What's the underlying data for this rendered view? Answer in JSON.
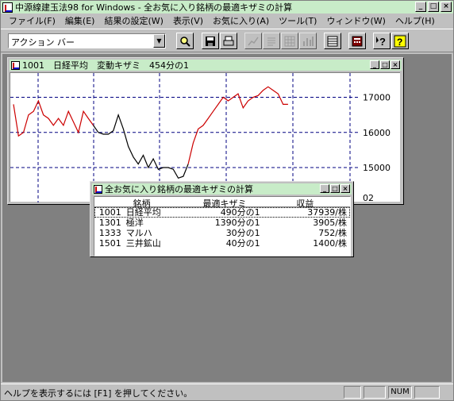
{
  "app": {
    "title": "中源線建玉法98 for Windows - 全お気に入り銘柄の最適キザミの計算"
  },
  "menu": [
    {
      "label": "ファイル(F)"
    },
    {
      "label": "編集(E)"
    },
    {
      "label": "結果の設定(W)"
    },
    {
      "label": "表示(V)"
    },
    {
      "label": "お気に入り(A)"
    },
    {
      "label": "ツール(T)"
    },
    {
      "label": "ウィンドウ(W)"
    },
    {
      "label": "ヘルプ(H)"
    }
  ],
  "toolbar": {
    "action_bar_value": "アクション バー"
  },
  "chart_window": {
    "title": "1001　日経平均　変動キザミ　454分の1",
    "axis_partial_label": "02"
  },
  "chart_data": {
    "type": "line",
    "x": [
      0,
      1,
      2,
      3,
      4,
      5,
      6,
      7,
      8,
      9,
      10,
      11,
      12,
      13,
      14,
      15,
      16,
      17,
      18,
      19,
      20,
      21,
      22,
      23,
      24,
      25,
      26,
      27,
      28,
      29,
      30,
      31,
      32,
      33,
      34,
      35,
      36,
      37,
      38,
      39,
      40,
      41,
      42,
      43,
      44,
      45,
      46,
      47,
      48,
      49,
      50,
      51,
      52,
      53,
      54,
      55,
      56,
      57,
      58,
      59,
      60,
      61,
      62,
      63,
      64,
      65,
      66,
      67,
      68,
      69
    ],
    "series": [
      {
        "color": "#cc0000",
        "values": [
          16800,
          15900,
          16000,
          16500,
          16600,
          16900,
          16500,
          16400,
          16200,
          16400,
          16200,
          16600,
          16300,
          16000,
          16600,
          16400,
          16200
        ]
      },
      {
        "color": "#000000",
        "values": [
          16200,
          16000,
          15950,
          15950,
          16050,
          16500,
          16100,
          15600,
          15300,
          15100,
          15350,
          15000,
          15250,
          14950,
          15000,
          15000,
          14950,
          14700,
          14750,
          15100
        ]
      },
      {
        "color": "#cc0000",
        "values": [
          15100,
          15700,
          16100,
          16200,
          16400,
          16600,
          16800,
          17000,
          16900,
          17000,
          17100,
          16700,
          16900,
          17000,
          17050,
          17200,
          17300,
          17200,
          17100,
          16800,
          16800
        ]
      }
    ],
    "y_ticks": [
      15000,
      16000,
      17000
    ],
    "ylim": [
      14300,
      17600
    ],
    "grid": true
  },
  "calc_window": {
    "title": "全お気に入り銘柄の最適キザミの計算",
    "columns": [
      "銘柄",
      "最適キザミ",
      "収益"
    ],
    "rows": [
      {
        "code": "1001",
        "name": "日経平均",
        "kizami": "490分の1",
        "profit": "37939/株"
      },
      {
        "code": "1301",
        "name": "極洋",
        "kizami": "1390分の1",
        "profit": "3905/株"
      },
      {
        "code": "1333",
        "name": "マルハ",
        "kizami": "30分の1",
        "profit": "752/株"
      },
      {
        "code": "1501",
        "name": "三井鉱山",
        "kizami": "40分の1",
        "profit": "1400/株"
      }
    ]
  },
  "statusbar": {
    "message": "ヘルプを表示するには [F1] を押してください。",
    "num": "NUM"
  }
}
